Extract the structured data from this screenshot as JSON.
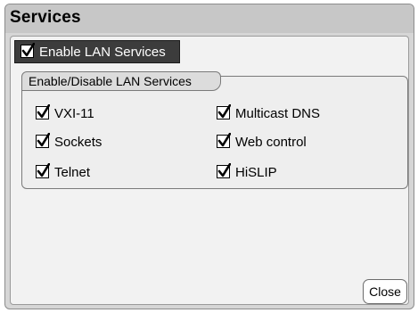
{
  "dialog": {
    "title": "Services"
  },
  "enable_lan": {
    "label": "Enable LAN Services",
    "checked": true
  },
  "group": {
    "title": "Enable/Disable LAN Services",
    "options": [
      {
        "label": "VXI-11",
        "checked": true
      },
      {
        "label": "Sockets",
        "checked": true
      },
      {
        "label": "Telnet",
        "checked": true
      },
      {
        "label": "Multicast DNS",
        "checked": true
      },
      {
        "label": "Web control",
        "checked": true
      },
      {
        "label": "HiSLIP",
        "checked": true
      }
    ]
  },
  "buttons": {
    "close_label": "Close"
  },
  "icons": {
    "check": "check-mark-icon"
  },
  "colors": {
    "highlight_bg": "#3c3c3c",
    "title_bar": "#c7c7c7",
    "panel_bg": "#f2f2f2"
  }
}
